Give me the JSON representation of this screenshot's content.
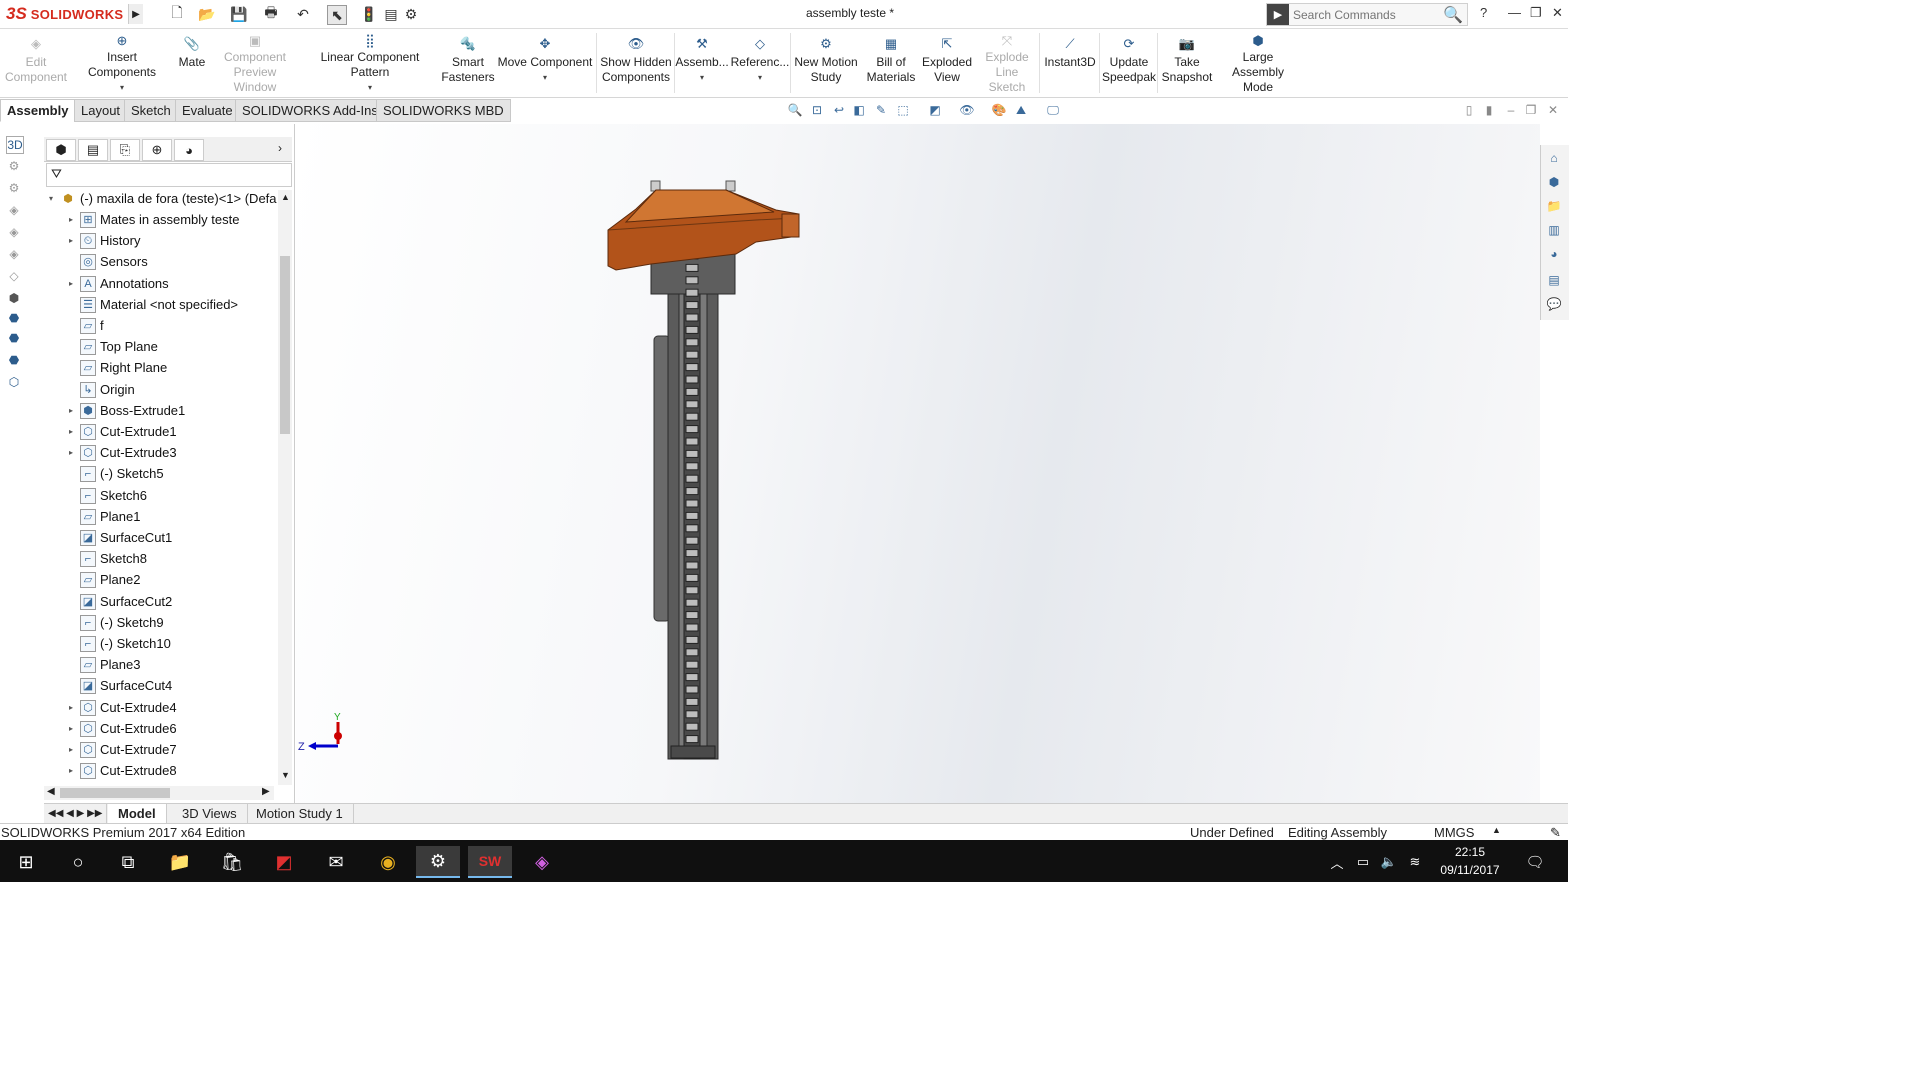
{
  "app": {
    "logo_ds": "3S",
    "logo_text": "SOLIDWORKS",
    "document_title": "assembly teste *",
    "search_placeholder": "Search Commands",
    "help": "?"
  },
  "command_manager": [
    {
      "label": "Edit Component",
      "disabled": true
    },
    {
      "label": "Insert Components",
      "disabled": false
    },
    {
      "label": "Mate",
      "disabled": false
    },
    {
      "label": "Component Preview Window",
      "disabled": true
    },
    {
      "label": "Linear Component Pattern",
      "disabled": false
    },
    {
      "label": "Smart Fasteners",
      "disabled": false
    },
    {
      "label": "Move Component",
      "disabled": false
    },
    {
      "label": "Show Hidden Components",
      "disabled": false
    },
    {
      "label": "Assemb...",
      "disabled": false
    },
    {
      "label": "Referenc...",
      "disabled": false
    },
    {
      "label": "New Motion Study",
      "disabled": false
    },
    {
      "label": "Bill of Materials",
      "disabled": false
    },
    {
      "label": "Exploded View",
      "disabled": false
    },
    {
      "label": "Explode Line Sketch",
      "disabled": true
    },
    {
      "label": "Instant3D",
      "disabled": false
    },
    {
      "label": "Update Speedpak",
      "disabled": false
    },
    {
      "label": "Take Snapshot",
      "disabled": false
    },
    {
      "label": "Large Assembly Mode",
      "disabled": false
    }
  ],
  "tabs": [
    "Assembly",
    "Layout",
    "Sketch",
    "Evaluate",
    "SOLIDWORKS Add-Ins",
    "SOLIDWORKS MBD"
  ],
  "feature_tree": {
    "root": "(-) maxila de fora (teste)<1> (Defa",
    "items": [
      {
        "label": "Mates in assembly teste",
        "expandable": true,
        "icon": "mates-icon"
      },
      {
        "label": "History",
        "expandable": true,
        "icon": "history-icon"
      },
      {
        "label": "Sensors",
        "expandable": false,
        "icon": "sensors-icon"
      },
      {
        "label": "Annotations",
        "expandable": true,
        "icon": "annotations-icon"
      },
      {
        "label": "Material <not specified>",
        "expandable": false,
        "icon": "material-icon"
      },
      {
        "label": "f",
        "expandable": false,
        "icon": "plane-icon"
      },
      {
        "label": "Top Plane",
        "expandable": false,
        "icon": "plane-icon"
      },
      {
        "label": "Right Plane",
        "expandable": false,
        "icon": "plane-icon"
      },
      {
        "label": "Origin",
        "expandable": false,
        "icon": "origin-icon"
      },
      {
        "label": "Boss-Extrude1",
        "expandable": true,
        "icon": "extrude-icon"
      },
      {
        "label": "Cut-Extrude1",
        "expandable": true,
        "icon": "cut-extrude-icon"
      },
      {
        "label": "Cut-Extrude3",
        "expandable": true,
        "icon": "cut-extrude-icon"
      },
      {
        "label": "(-) Sketch5",
        "expandable": false,
        "icon": "sketch-icon"
      },
      {
        "label": "Sketch6",
        "expandable": false,
        "icon": "sketch-icon"
      },
      {
        "label": "Plane1",
        "expandable": false,
        "icon": "plane-icon"
      },
      {
        "label": "SurfaceCut1",
        "expandable": false,
        "icon": "surface-cut-icon"
      },
      {
        "label": "Sketch8",
        "expandable": false,
        "icon": "sketch-icon"
      },
      {
        "label": "Plane2",
        "expandable": false,
        "icon": "plane-icon"
      },
      {
        "label": "SurfaceCut2",
        "expandable": false,
        "icon": "surface-cut-icon"
      },
      {
        "label": "(-) Sketch9",
        "expandable": false,
        "icon": "sketch-icon"
      },
      {
        "label": "(-) Sketch10",
        "expandable": false,
        "icon": "sketch-icon"
      },
      {
        "label": "Plane3",
        "expandable": false,
        "icon": "plane-icon"
      },
      {
        "label": "SurfaceCut4",
        "expandable": false,
        "icon": "surface-cut-icon"
      },
      {
        "label": "Cut-Extrude4",
        "expandable": true,
        "icon": "cut-extrude-icon"
      },
      {
        "label": "Cut-Extrude6",
        "expandable": true,
        "icon": "cut-extrude-icon"
      },
      {
        "label": "Cut-Extrude7",
        "expandable": true,
        "icon": "cut-extrude-icon"
      },
      {
        "label": "Cut-Extrude8",
        "expandable": true,
        "icon": "cut-extrude-icon"
      }
    ]
  },
  "triad": {
    "y": "Y",
    "z": "Z"
  },
  "bottom_tabs": [
    "Model",
    "3D Views",
    "Motion Study 1"
  ],
  "status": {
    "edition": "SOLIDWORKS Premium 2017 x64 Edition",
    "defined": "Under Defined",
    "mode": "Editing Assembly",
    "units": "MMGS"
  },
  "taskbar": {
    "time": "22:15",
    "date": "09/11/2017",
    "sw_badge": "SW"
  },
  "colors": {
    "accent_red": "#d52b1e",
    "part_orange": "#b2531a",
    "part_gray": "#5a5a5a"
  }
}
